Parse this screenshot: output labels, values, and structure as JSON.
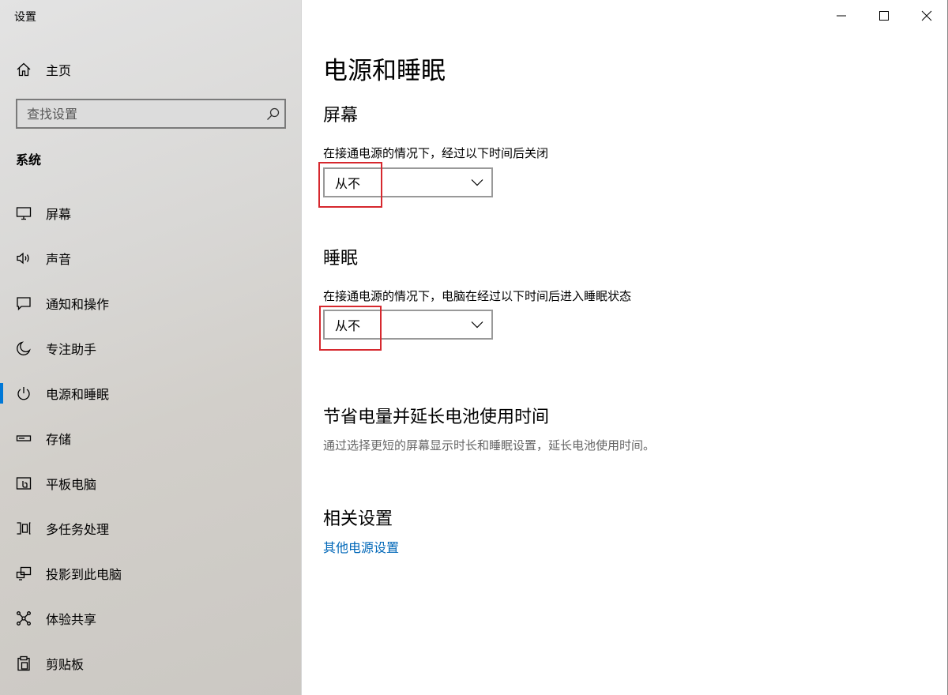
{
  "app_title": "设置",
  "sidebar": {
    "home_label": "主页",
    "search_placeholder": "查找设置",
    "category": "系统",
    "items": [
      {
        "label": "屏幕",
        "icon": "monitor-icon"
      },
      {
        "label": "声音",
        "icon": "speaker-icon"
      },
      {
        "label": "通知和操作",
        "icon": "notification-icon"
      },
      {
        "label": "专注助手",
        "icon": "moon-icon"
      },
      {
        "label": "电源和睡眠",
        "icon": "power-icon",
        "selected": true
      },
      {
        "label": "存储",
        "icon": "storage-icon"
      },
      {
        "label": "平板电脑",
        "icon": "tablet-icon"
      },
      {
        "label": "多任务处理",
        "icon": "multitask-icon"
      },
      {
        "label": "投影到此电脑",
        "icon": "projection-icon"
      },
      {
        "label": "体验共享",
        "icon": "share-icon"
      },
      {
        "label": "剪贴板",
        "icon": "clipboard-icon"
      }
    ]
  },
  "main": {
    "title": "电源和睡眠",
    "screen": {
      "heading": "屏幕",
      "description": "在接通电源的情况下，经过以下时间后关闭",
      "value": "从不"
    },
    "sleep": {
      "heading": "睡眠",
      "description": "在接通电源的情况下，电脑在经过以下时间后进入睡眠状态",
      "value": "从不"
    },
    "battery": {
      "heading": "节省电量并延长电池使用时间",
      "description": "通过选择更短的屏幕显示时长和睡眠设置，延长电池使用时间。"
    },
    "related": {
      "heading": "相关设置",
      "link": "其他电源设置"
    }
  },
  "colors": {
    "accent": "#0078d7",
    "link": "#0067b8",
    "highlight": "#d6282e"
  }
}
